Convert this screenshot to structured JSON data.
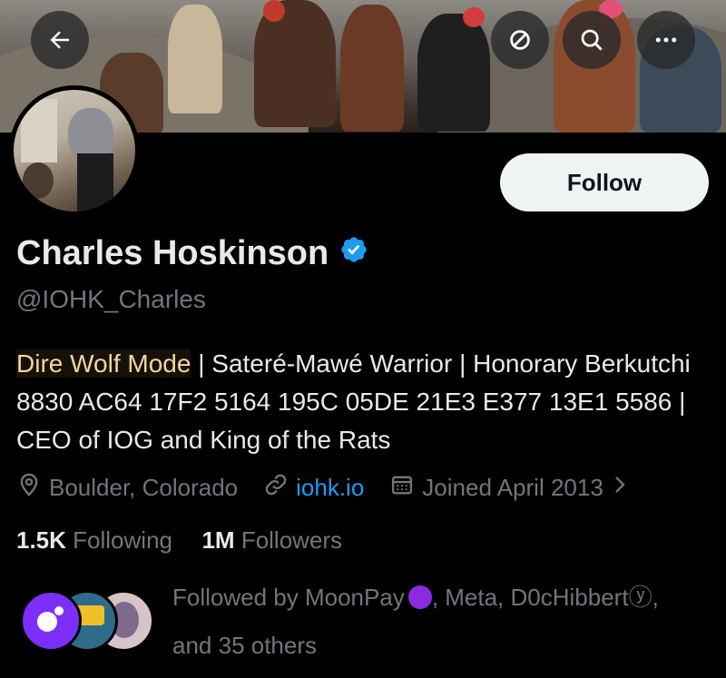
{
  "header": {
    "back_icon": "arrow-left-icon",
    "actions": [
      "no-sign-icon",
      "search-icon",
      "more-icon"
    ]
  },
  "profile": {
    "name": "Charles Hoskinson",
    "handle": "@IOHK_Charles",
    "follow_label": "Follow",
    "bio_highlight": "Dire Wolf Mode",
    "bio_rest": " | Sateré-Mawé Warrior | Honorary Berkutchi 8830 AC64 17F2 5164 195C 05DE 21E3 E377 13E1 5586 | CEO of IOG and King of the Rats",
    "location": "Boulder, Colorado",
    "website": "iohk.io",
    "joined": "Joined April 2013",
    "following_count": "1.5K",
    "following_label": "Following",
    "followers_count": "1M",
    "followers_label": "Followers"
  },
  "followed_by": {
    "prefix": "Followed by MoonPay",
    "middle": ", Meta, D0cHibbert",
    "symbol": "ⓨ",
    "tail": ",",
    "line2": "and 35 others"
  },
  "colors": {
    "background": "#000000",
    "text": "#e7e9ea",
    "muted": "#71767b",
    "link": "#1d9bf0",
    "highlight": "#f4d59b",
    "follow_bg": "#eff3f4"
  }
}
